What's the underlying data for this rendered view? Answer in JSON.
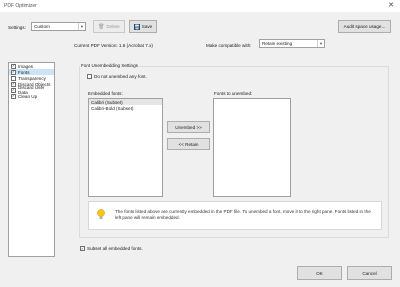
{
  "window": {
    "title": "PDF Optimizer",
    "close_glyph": "✕"
  },
  "toolbar": {
    "settings_label": "Settings:",
    "settings_value": "Custom",
    "delete_label": "Delete",
    "save_label": "Save",
    "audit_label": "Audit space usage..."
  },
  "version": {
    "current_label": "Current PDF Version: 1.6 (Acrobat 7.x)",
    "compat_label": "Make compatible with:",
    "compat_value": "Retain existing"
  },
  "categories": [
    {
      "label": "Images",
      "checked": true,
      "selected": false
    },
    {
      "label": "Fonts",
      "checked": true,
      "selected": true
    },
    {
      "label": "Transparency",
      "checked": false,
      "selected": false
    },
    {
      "label": "Discard Objects",
      "checked": true,
      "selected": false
    },
    {
      "label": "Discard User Data",
      "checked": true,
      "selected": false
    },
    {
      "label": "Clean Up",
      "checked": true,
      "selected": false
    }
  ],
  "fonts_panel": {
    "group_title": "Font Unembedding Settings",
    "do_not_unembed_label": "Do not unembed any font.",
    "embedded_label": "Embedded fonts:",
    "embedded_fonts": [
      "Calibri (Subset)",
      "Calibri-Bold (Subset)"
    ],
    "unembed_label": "Fonts to unembed:",
    "unembed_button": "Unembed >>",
    "retain_button": "<< Retain",
    "info_text": "The fonts listed above are currently embedded in the PDF file. To unembed a font, move it to the right pane. Fonts listed in the left pane will remain embedded.",
    "subset_label": "Subset all embedded fonts.",
    "subset_checked": true
  },
  "footer": {
    "ok_label": "OK",
    "cancel_label": "Cancel"
  },
  "colors": {
    "selected_category": "#cce4f7",
    "info_icon": "#f5c518"
  }
}
